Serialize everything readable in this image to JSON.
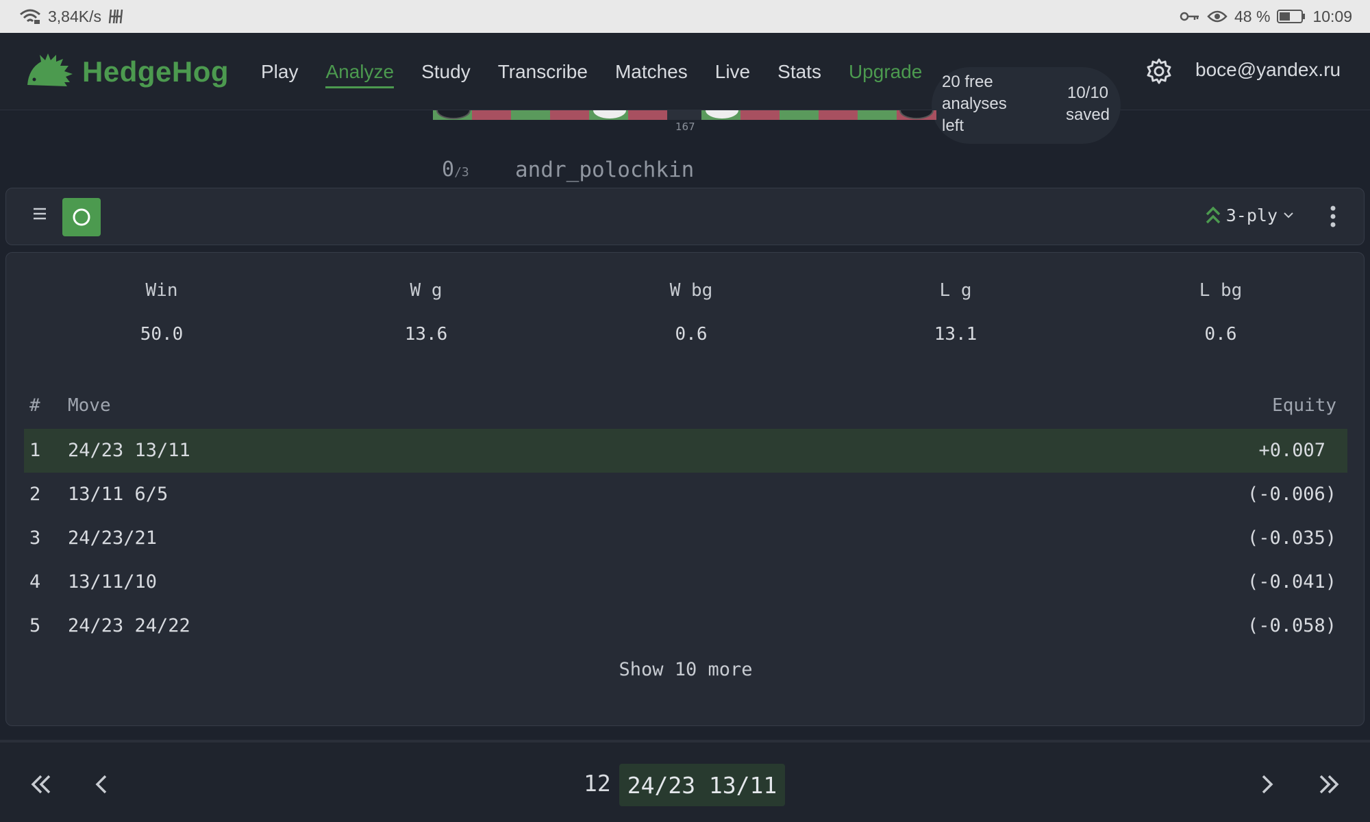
{
  "status_bar": {
    "net_speed": "3,84K/s",
    "battery_percent": "48 %",
    "time": "10:09"
  },
  "nav": {
    "logo": "HedgeHog",
    "links": [
      "Play",
      "Analyze",
      "Study",
      "Transcribe",
      "Matches",
      "Live",
      "Stats"
    ],
    "upgrade": "Upgrade",
    "free_analyses": "20 free analyses left",
    "saved": "10/10 saved",
    "email": "boce@yandex.ru",
    "accent_color": "#4c9a4f"
  },
  "board": {
    "pip_count": "167",
    "score": "0",
    "match_length": "/3",
    "player_name": "andr_polochkin"
  },
  "toolbar": {
    "ply": "3-ply"
  },
  "stats": {
    "labels": [
      "Win",
      "W g",
      "W bg",
      "L g",
      "L bg"
    ],
    "values": [
      "50.0",
      "13.6",
      "0.6",
      "13.1",
      "0.6"
    ]
  },
  "moves_table": {
    "headers": {
      "num": "#",
      "move": "Move",
      "equity": "Equity"
    },
    "rows": [
      {
        "num": "1",
        "move": "24/23 13/11",
        "equity": "+0.007"
      },
      {
        "num": "2",
        "move": "13/11 6/5",
        "equity": "(-0.006)"
      },
      {
        "num": "3",
        "move": "24/23/21",
        "equity": "(-0.035)"
      },
      {
        "num": "4",
        "move": "13/11/10",
        "equity": "(-0.041)"
      },
      {
        "num": "5",
        "move": "24/23 24/22",
        "equity": "(-0.058)"
      }
    ],
    "show_more": "Show 10 more"
  },
  "bottom_nav": {
    "move_number": "12",
    "current_move": "24/23 13/11"
  }
}
